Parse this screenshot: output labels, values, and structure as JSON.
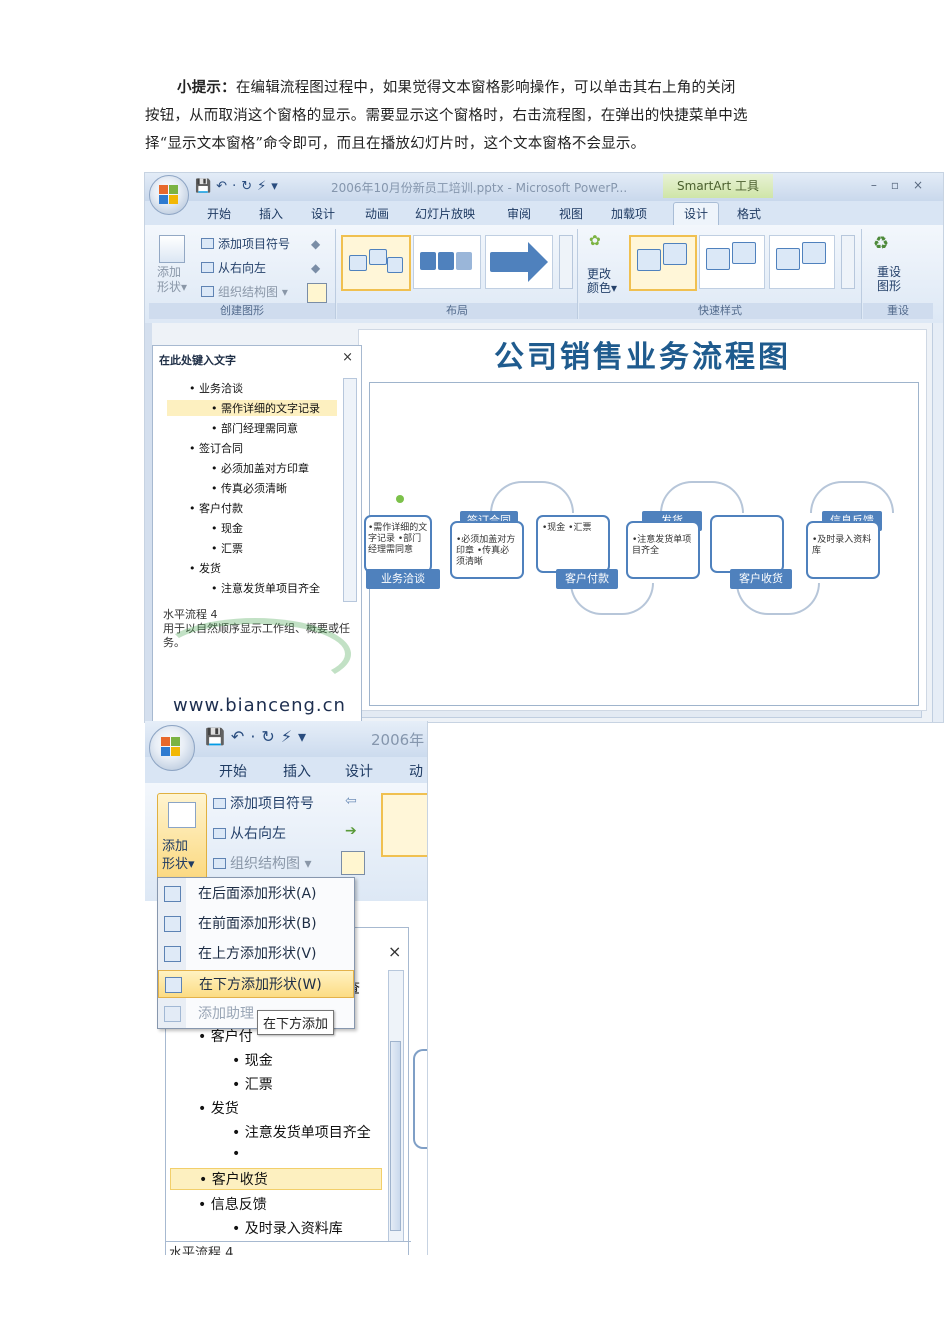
{
  "tip": {
    "label": "小提示：",
    "line1": "在编辑流程图过程中，如果觉得文本窗格影响操作，可以单击其右上角的关闭",
    "line2": "按钮，从而取消这个窗格的显示。需要显示这个窗格时，右击流程图，在弹出的快捷菜单中选",
    "line3": "择“显示文本窗格”命令即可，而且在播放幻灯片时，这个文本窗格不会显示。"
  },
  "shot1": {
    "window_title": "2006年10月份新员工培训.pptx - Microsoft PowerP...",
    "context_tab_title": "SmartArt 工具",
    "tabs": [
      "开始",
      "插入",
      "设计",
      "动画",
      "幻灯片放映",
      "审阅",
      "视图",
      "加载项",
      "设计",
      "格式"
    ],
    "ribbon": {
      "add_bullet": "添加项目符号",
      "right_to_left": "从右向左",
      "org_chart": "组织结构图",
      "add_shape_line1": "添加",
      "add_shape_line2": "形状",
      "change_colors_line1": "更改",
      "change_colors_line2": "颜色",
      "reset_line1": "重设",
      "reset_line2": "图形",
      "group_create": "创建图形",
      "group_layout": "布局",
      "group_styles": "快速样式",
      "group_reset": "重设"
    },
    "slide_title": "公司销售业务流程图",
    "nodes": [
      {
        "label": "业务洽谈",
        "text": "•需作详细的文字记录 •部门经理需同意"
      },
      {
        "label": "签订合同",
        "text": "•必须加盖对方印章 •传真必须清晰"
      },
      {
        "label": "客户付款",
        "text": "•现金 •汇票"
      },
      {
        "label": "发货",
        "text": "•注意发货单项目齐全"
      },
      {
        "label": "客户收货",
        "text": ""
      },
      {
        "label": "信息反馈",
        "text": "•及时录入资料库"
      }
    ],
    "text_pane": {
      "title": "在此处键入文字",
      "close": "×",
      "items": [
        {
          "level": 1,
          "text": "业务洽谈"
        },
        {
          "level": 2,
          "text": "需作详细的文字记录"
        },
        {
          "level": 2,
          "text": "部门经理需同意"
        },
        {
          "level": 1,
          "text": "签订合同"
        },
        {
          "level": 2,
          "text": "必须加盖对方印章"
        },
        {
          "level": 2,
          "text": "传真必须清晰"
        },
        {
          "level": 1,
          "text": "客户付款"
        },
        {
          "level": 2,
          "text": "现金"
        },
        {
          "level": 2,
          "text": "汇票"
        },
        {
          "level": 1,
          "text": "发货"
        },
        {
          "level": 2,
          "text": "注意发货单项目齐全"
        }
      ],
      "desc_title": "水平流程 4",
      "desc_text": "用于以自然顺序显示工作组、概要或任务。"
    },
    "watermark": "www.bianceng.cn"
  },
  "shot2": {
    "window_title": "2006年",
    "tabs": [
      "开始",
      "插入",
      "设计",
      "动"
    ],
    "add_bullet": "添加项目符号",
    "right_to_left": "从右向左",
    "org_chart": "组织结构图",
    "add_shape_line1": "添加",
    "add_shape_line2": "形状",
    "menu": [
      {
        "text": "在后面添加形状(A)",
        "state": "normal"
      },
      {
        "text": "在前面添加形状(B)",
        "state": "normal"
      },
      {
        "text": "在上方添加形状(V)",
        "state": "normal"
      },
      {
        "text": "在下方添加形状(W)",
        "state": "selected"
      },
      {
        "text": "添加助理",
        "state": "disabled"
      }
    ],
    "tooltip": "在下方添加",
    "pane_close": "×",
    "pane_items": [
      {
        "level": 1,
        "text": "客户付"
      },
      {
        "level": 2,
        "text": "现金"
      },
      {
        "level": 2,
        "text": "汇票"
      },
      {
        "level": 1,
        "text": "发货"
      },
      {
        "level": 2,
        "text": "注意发货单项目齐全"
      },
      {
        "level": 2,
        "text": ""
      },
      {
        "level": 1,
        "text": "客户收货"
      },
      {
        "level": 1,
        "text": "信息反馈"
      },
      {
        "level": 2,
        "text": "及时录入资料库"
      }
    ],
    "pane_footer": "水平流程 4",
    "partial_text": "查"
  }
}
